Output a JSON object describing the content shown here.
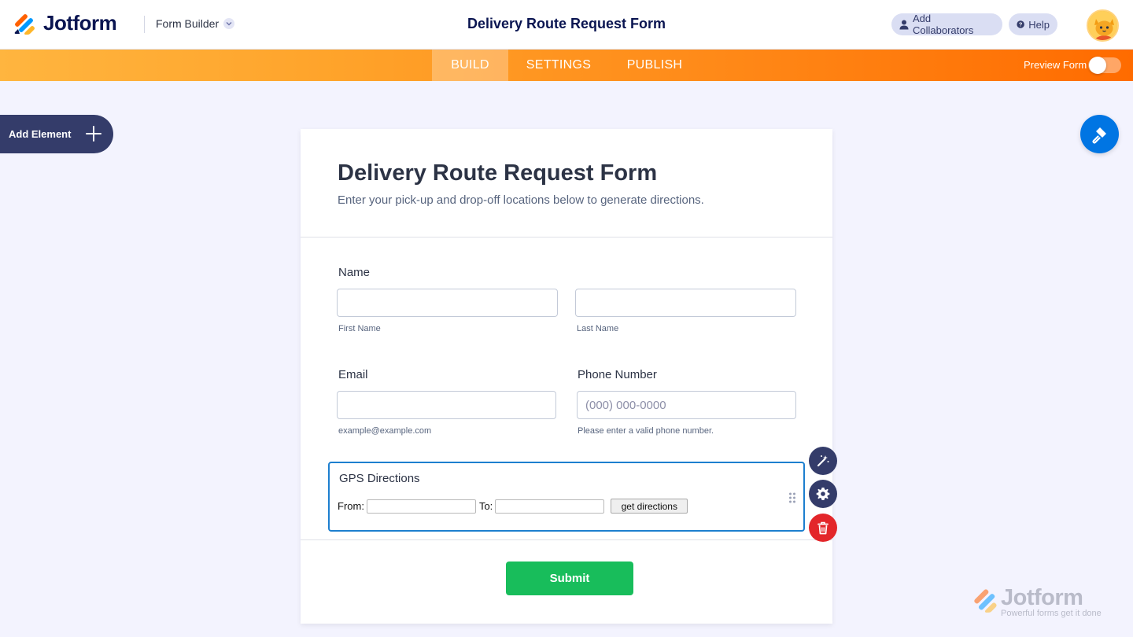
{
  "app": {
    "brand": "Jotform",
    "builder_label": "Form Builder",
    "form_title": "Delivery Route Request Form"
  },
  "header": {
    "collab_label": "Add Collaborators",
    "help_label": "Help"
  },
  "nav": {
    "tabs": [
      "BUILD",
      "SETTINGS",
      "PUBLISH"
    ],
    "active_tab": "BUILD",
    "preview_label": "Preview Form",
    "preview_enabled": false
  },
  "sidebar": {
    "add_element_label": "Add Element"
  },
  "form": {
    "title": "Delivery Route Request Form",
    "subtitle": "Enter your pick-up and drop-off locations below to generate directions.",
    "name": {
      "label": "Name",
      "first_sublabel": "First Name",
      "last_sublabel": "Last Name",
      "first_value": "",
      "last_value": ""
    },
    "email": {
      "label": "Email",
      "sublabel": "example@example.com",
      "value": ""
    },
    "phone": {
      "label": "Phone Number",
      "placeholder": "(000) 000-0000",
      "sublabel": "Please enter a valid phone number.",
      "value": ""
    },
    "gps": {
      "label": "GPS Directions",
      "from_label": "From:",
      "to_label": "To:",
      "from_value": "",
      "to_value": "",
      "button_label": "get directions"
    },
    "submit_label": "Submit"
  },
  "watermark": {
    "brand": "Jotform",
    "tagline": "Powerful forms get it done"
  },
  "colors": {
    "accent_blue": "#0075e3",
    "submit_green": "#18bd5b",
    "delete_red": "#e3262a",
    "navy": "#343c6a",
    "nav_orange": "#ff8c1a"
  }
}
